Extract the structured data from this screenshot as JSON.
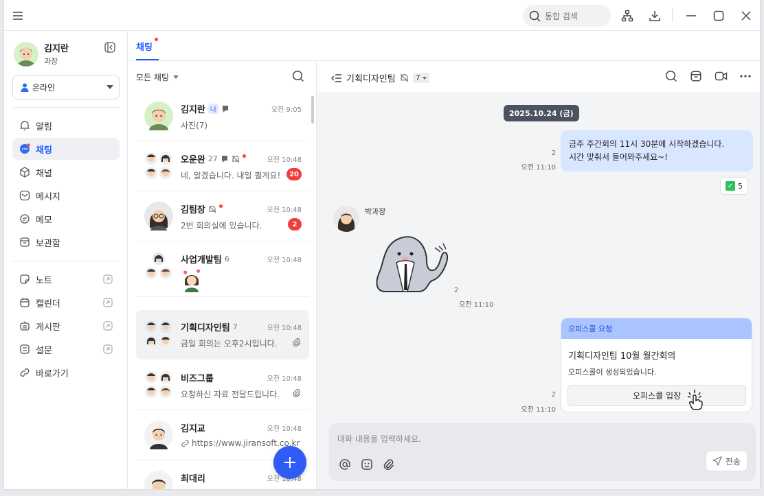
{
  "titlebar": {
    "search_placeholder": "통합 검색",
    "icons": [
      "menu-icon",
      "search-icon",
      "org-chart-icon",
      "download-icon",
      "minimize-icon",
      "maximize-icon",
      "close-icon"
    ]
  },
  "profile": {
    "name": "김지란",
    "rank": "과장"
  },
  "status": {
    "selected": "온라인",
    "color": "#2f6cf5"
  },
  "nav": {
    "main": [
      {
        "label": "알림",
        "icon": "bell-icon"
      },
      {
        "label": "채팅",
        "icon": "chat-icon",
        "active": true
      },
      {
        "label": "채널",
        "icon": "cube-icon"
      },
      {
        "label": "메시지",
        "icon": "envelope-icon"
      },
      {
        "label": "메모",
        "icon": "memo-icon"
      },
      {
        "label": "보관함",
        "icon": "archive-icon"
      }
    ],
    "external": [
      {
        "label": "노트",
        "icon": "note-icon"
      },
      {
        "label": "캘린더",
        "icon": "calendar-icon"
      },
      {
        "label": "게시판",
        "icon": "board-icon"
      },
      {
        "label": "설문",
        "icon": "survey-icon"
      },
      {
        "label": "바로가기",
        "icon": "link-icon"
      }
    ]
  },
  "tabs": {
    "chat": "채팅"
  },
  "chatlist": {
    "filter": "모든 채팅",
    "rows": [
      {
        "name": "김지란",
        "me_tag": "나",
        "time": "오전 9:05",
        "preview": "사진(7)"
      },
      {
        "name": "오운완",
        "count": "27",
        "time": "오전 10:48",
        "preview": "네, 알겠습니다. 내일 뵐게요!",
        "badge": "20"
      },
      {
        "name": "김팀장",
        "time": "오전 10:48",
        "preview": "2번 회의실에 있습니다.",
        "badge": "2"
      },
      {
        "name": "사업개발팀",
        "count": "6",
        "time": "오전 10:48",
        "preview": ""
      },
      {
        "name": "기획디자인팀",
        "count": "7",
        "time": "오전 10:48",
        "preview": "금일 회의는 오후2시입니다."
      },
      {
        "name": "비즈그룹",
        "time": "오전 10:48",
        "preview": "요청하신 자료 전달드립니다."
      },
      {
        "name": "김지교",
        "time": "오전 10:48",
        "preview": "https://www.jiransoft.co.kr"
      },
      {
        "name": "최대리",
        "time": "오전 10:48",
        "preview": ""
      }
    ]
  },
  "room": {
    "title": "기획디자인팀",
    "member_count": "7",
    "date": "2025.10.24 (금)",
    "my_message": {
      "line1": "금주 주간회의 11시 30분에 시작하겠습니다.",
      "line2": "시간 맞춰서 들어와주세요~!",
      "read": "2",
      "time": "오전 11:10",
      "reaction_count": "5"
    },
    "other_message": {
      "sender": "박과장",
      "read": "2",
      "time": "오전 11:10"
    },
    "call_card": {
      "header": "오피스콜 요청",
      "title": "기획디자인팀 10월 월간회의",
      "desc": "오피스콜이 생성되었습니다.",
      "button": "오피스콜 입장",
      "read": "2",
      "time": "오전 11:10"
    },
    "composer": {
      "placeholder": "대화 내용을 입력하세요.",
      "send": "전송"
    }
  },
  "colors": {
    "accent": "#1f5cff",
    "badge": "#f23c3c",
    "fab": "#2e5cf5",
    "my_bubble": "#d8e7ff"
  }
}
